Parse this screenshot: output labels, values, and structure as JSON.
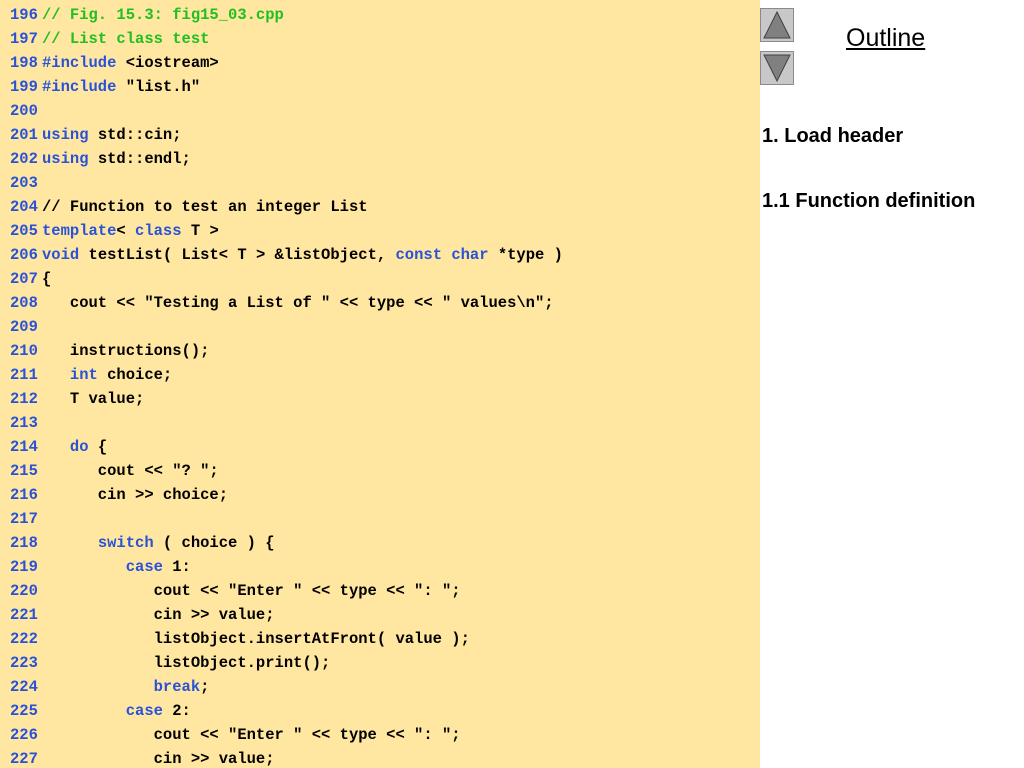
{
  "outline": {
    "title": "Outline",
    "items": [
      "1. Load header",
      "1.1 Function definition"
    ]
  },
  "navigation": {
    "up_icon": "triangle-up-icon",
    "down_icon": "triangle-down-icon"
  },
  "colors": {
    "code_background": "#ffe6a1",
    "line_number": "#2a52d8",
    "keyword": "#2a52d8",
    "comment": "#20c020",
    "text": "#000000"
  },
  "code": {
    "lines": [
      {
        "num": "196",
        "tokens": [
          {
            "t": "// Fig. 15.3: fig15_03.cpp",
            "c": "comment"
          }
        ]
      },
      {
        "num": "197",
        "tokens": [
          {
            "t": "// List class test",
            "c": "comment"
          }
        ]
      },
      {
        "num": "198",
        "tokens": [
          {
            "t": "#include",
            "c": "directive"
          },
          {
            "t": " <iostream>",
            "c": ""
          }
        ]
      },
      {
        "num": "199",
        "tokens": [
          {
            "t": "#include",
            "c": "directive"
          },
          {
            "t": " \"list.h\"",
            "c": ""
          }
        ]
      },
      {
        "num": "200",
        "tokens": []
      },
      {
        "num": "201",
        "tokens": [
          {
            "t": "using",
            "c": "keyword"
          },
          {
            "t": " std::cin;",
            "c": ""
          }
        ]
      },
      {
        "num": "202",
        "tokens": [
          {
            "t": "using",
            "c": "keyword"
          },
          {
            "t": " std::endl;",
            "c": ""
          }
        ]
      },
      {
        "num": "203",
        "tokens": []
      },
      {
        "num": "204",
        "tokens": [
          {
            "t": "// Function to test an integer List",
            "c": ""
          }
        ]
      },
      {
        "num": "205",
        "tokens": [
          {
            "t": "template",
            "c": "keyword"
          },
          {
            "t": "< ",
            "c": ""
          },
          {
            "t": "class",
            "c": "keyword"
          },
          {
            "t": " T >",
            "c": ""
          }
        ]
      },
      {
        "num": "206",
        "tokens": [
          {
            "t": "void",
            "c": "keyword"
          },
          {
            "t": " testList( List< T > &listObject, ",
            "c": ""
          },
          {
            "t": "const",
            "c": "keyword"
          },
          {
            "t": " ",
            "c": ""
          },
          {
            "t": "char",
            "c": "keyword"
          },
          {
            "t": " *type )",
            "c": ""
          }
        ]
      },
      {
        "num": "207",
        "tokens": [
          {
            "t": "{",
            "c": ""
          }
        ]
      },
      {
        "num": "208",
        "tokens": [
          {
            "t": "   cout << \"Testing a List of \" << type << \" values\\n\";",
            "c": ""
          }
        ]
      },
      {
        "num": "209",
        "tokens": []
      },
      {
        "num": "210",
        "tokens": [
          {
            "t": "   instructions();",
            "c": ""
          }
        ]
      },
      {
        "num": "211",
        "tokens": [
          {
            "t": "   ",
            "c": ""
          },
          {
            "t": "int",
            "c": "keyword"
          },
          {
            "t": " choice;",
            "c": ""
          }
        ]
      },
      {
        "num": "212",
        "tokens": [
          {
            "t": "   T value;",
            "c": ""
          }
        ]
      },
      {
        "num": "213",
        "tokens": []
      },
      {
        "num": "214",
        "tokens": [
          {
            "t": "   ",
            "c": ""
          },
          {
            "t": "do",
            "c": "keyword"
          },
          {
            "t": " {",
            "c": ""
          }
        ]
      },
      {
        "num": "215",
        "tokens": [
          {
            "t": "      cout << \"? \";",
            "c": ""
          }
        ]
      },
      {
        "num": "216",
        "tokens": [
          {
            "t": "      cin >> choice;",
            "c": ""
          }
        ]
      },
      {
        "num": "217",
        "tokens": []
      },
      {
        "num": "218",
        "tokens": [
          {
            "t": "      ",
            "c": ""
          },
          {
            "t": "switch",
            "c": "keyword"
          },
          {
            "t": " ( choice ) {",
            "c": ""
          }
        ]
      },
      {
        "num": "219",
        "tokens": [
          {
            "t": "         ",
            "c": ""
          },
          {
            "t": "case",
            "c": "keyword"
          },
          {
            "t": " 1:",
            "c": ""
          }
        ]
      },
      {
        "num": "220",
        "tokens": [
          {
            "t": "            cout << \"Enter \" << type << \": \";",
            "c": ""
          }
        ]
      },
      {
        "num": "221",
        "tokens": [
          {
            "t": "            cin >> value;",
            "c": ""
          }
        ]
      },
      {
        "num": "222",
        "tokens": [
          {
            "t": "            listObject.insertAtFront( value );",
            "c": ""
          }
        ]
      },
      {
        "num": "223",
        "tokens": [
          {
            "t": "            listObject.print();",
            "c": ""
          }
        ]
      },
      {
        "num": "224",
        "tokens": [
          {
            "t": "            ",
            "c": ""
          },
          {
            "t": "break",
            "c": "keyword"
          },
          {
            "t": ";",
            "c": ""
          }
        ]
      },
      {
        "num": "225",
        "tokens": [
          {
            "t": "         ",
            "c": ""
          },
          {
            "t": "case",
            "c": "keyword"
          },
          {
            "t": " 2:",
            "c": ""
          }
        ]
      },
      {
        "num": "226",
        "tokens": [
          {
            "t": "            cout << \"Enter \" << type << \": \";",
            "c": ""
          }
        ]
      },
      {
        "num": "227",
        "tokens": [
          {
            "t": "            cin >> value;",
            "c": ""
          }
        ]
      }
    ]
  }
}
